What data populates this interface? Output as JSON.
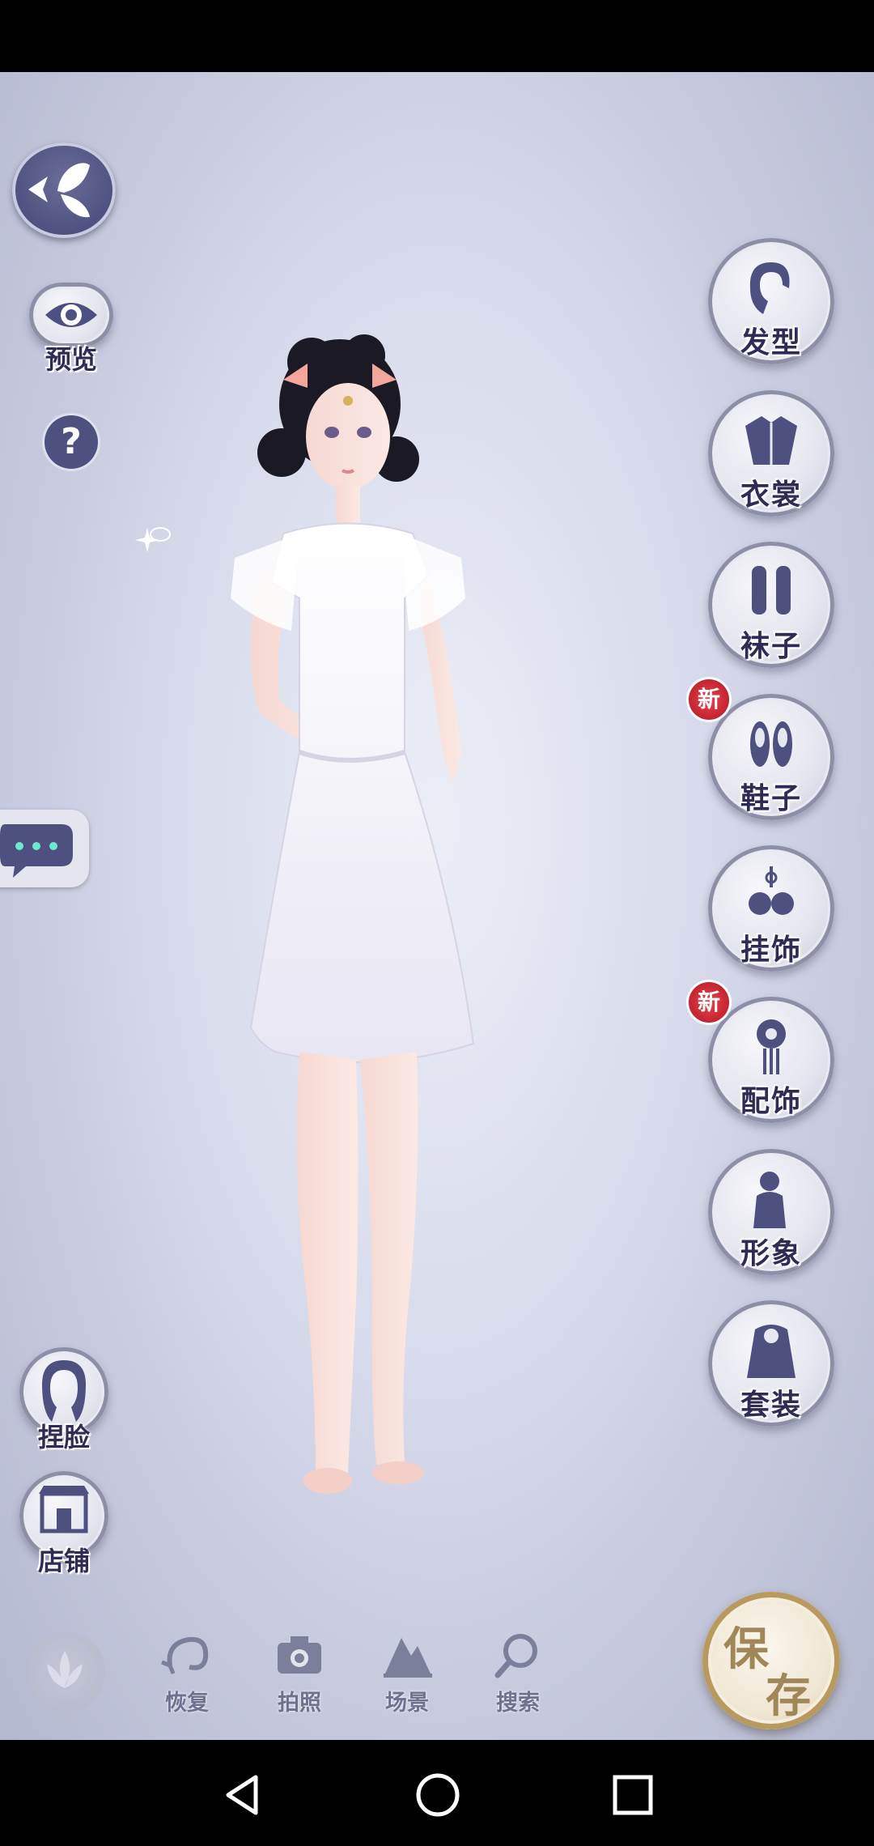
{
  "left_menu": {
    "back_icon": "butterfly-back-icon",
    "preview_label": "预览",
    "help_label": "?",
    "face_label": "捏脸",
    "shop_label": "店铺"
  },
  "categories": [
    {
      "label": "发型",
      "icon": "hairstyle-icon",
      "new": false
    },
    {
      "label": "衣裳",
      "icon": "clothes-icon",
      "new": false
    },
    {
      "label": "袜子",
      "icon": "socks-icon",
      "new": false
    },
    {
      "label": "鞋子",
      "icon": "shoes-icon",
      "new": true
    },
    {
      "label": "挂饰",
      "icon": "pendant-icon",
      "new": false
    },
    {
      "label": "配饰",
      "icon": "accessory-icon",
      "new": true
    },
    {
      "label": "形象",
      "icon": "appearance-icon",
      "new": false
    },
    {
      "label": "套装",
      "icon": "outfit-set-icon",
      "new": false
    }
  ],
  "new_badge": "新",
  "bottom_bar": {
    "restore_label": "恢复",
    "photo_label": "拍照",
    "scene_label": "场景",
    "search_label": "搜索",
    "save_label_1": "保",
    "save_label_2": "存"
  },
  "colors": {
    "label_text": "#2e2c55",
    "badge_red": "#c4242f",
    "save_gold": "#b89a5e"
  }
}
